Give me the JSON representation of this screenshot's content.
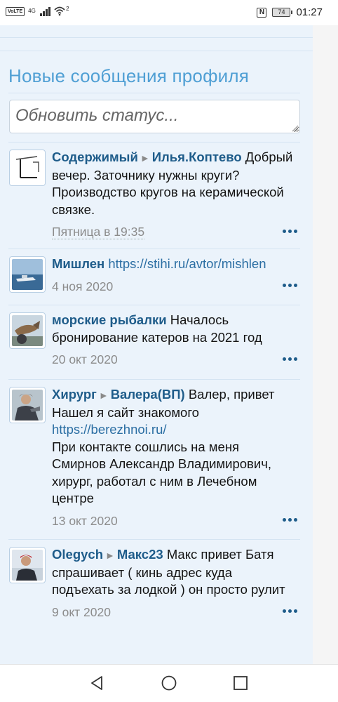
{
  "status_bar": {
    "volte": "VoLTE",
    "network": "4G",
    "wifi_badge": "2",
    "nfc": "N",
    "battery": "74",
    "time": "01:27"
  },
  "block": {
    "title": "Новые сообщения профиля",
    "status_placeholder": "Обновить статус..."
  },
  "arrow_glyph": "►",
  "more_icon": "ellipsis-icon",
  "items": [
    {
      "user": "Содержимый",
      "target": "Илья.Коптево",
      "message": "Добрый вечер. Заточнику нужны круги? Производство кругов на керамической связке.",
      "date": "Пятница в 19:35"
    },
    {
      "user": "Мишлен",
      "link": "https://stihi.ru/avtor/mishlen",
      "date": "4 ноя 2020"
    },
    {
      "user": "морские рыбалки",
      "message": "Началось бронирование катеров на 2021 год",
      "date": "20 окт 2020"
    },
    {
      "user": "Хирург",
      "target": "Валера(ВП)",
      "message": "Валер, привет Нашел я сайт знакомого",
      "link": "https://berezhnoi.ru/",
      "message2": "При контакте сошлись на меня Смирнов Александр Владимирович, хирург, работал с ним в Лечебном центре",
      "date": "13 окт 2020"
    },
    {
      "user": "Olegych",
      "target": "Макс23",
      "message": "Макс привет Батя спрашивает ( кинь адрес куда подъехать за лодкой ) он просто рулит",
      "date": "9 окт 2020"
    }
  ]
}
